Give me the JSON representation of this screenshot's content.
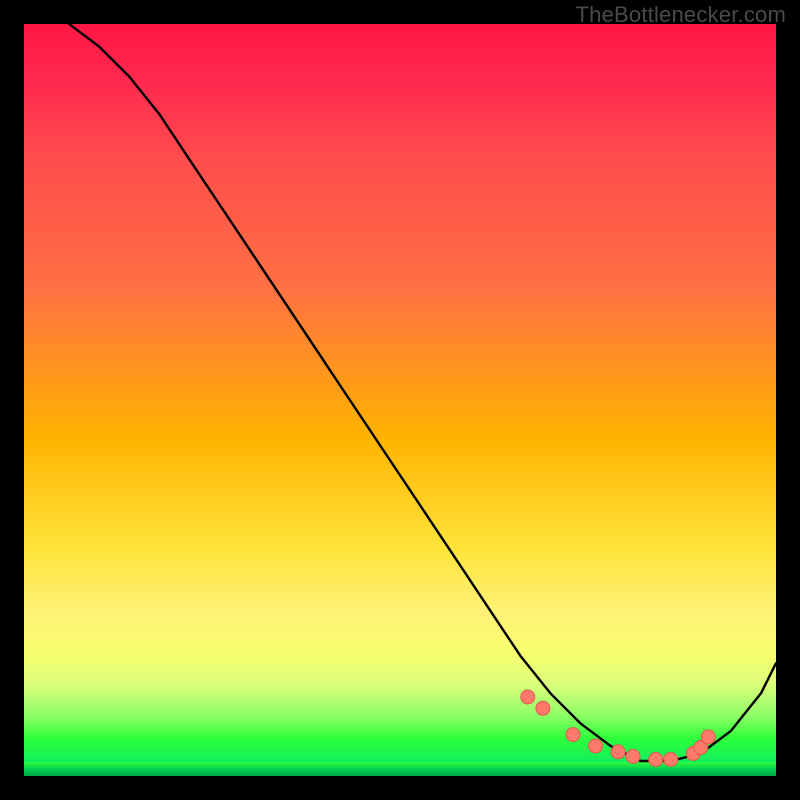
{
  "watermark": "TheBottlenecker.com",
  "chart_data": {
    "type": "line",
    "title": "",
    "xlabel": "",
    "ylabel": "",
    "xlim": [
      0,
      100
    ],
    "ylim": [
      0,
      100
    ],
    "grid": false,
    "series": [
      {
        "name": "curve",
        "x": [
          6,
          10,
          14,
          18,
          22,
          26,
          30,
          34,
          38,
          42,
          46,
          50,
          54,
          58,
          62,
          66,
          70,
          74,
          78,
          82,
          86,
          90,
          94,
          98,
          100
        ],
        "y": [
          100,
          97,
          93,
          88,
          82,
          76,
          70,
          64,
          58,
          52,
          46,
          40,
          34,
          28,
          22,
          16,
          11,
          7,
          4,
          2,
          2,
          3,
          6,
          11,
          15
        ]
      }
    ],
    "markers": {
      "name": "highlight-points",
      "x": [
        67,
        69,
        73,
        76,
        79,
        81,
        84,
        86,
        89,
        90,
        91
      ],
      "y": [
        10.5,
        9.0,
        5.5,
        4.0,
        3.2,
        2.6,
        2.2,
        2.2,
        3.0,
        3.8,
        5.2
      ]
    },
    "colors": {
      "line": "#000000",
      "markers": "#ff7a6b",
      "gradient_top": "#ff1744",
      "gradient_bottom": "#00c853"
    }
  }
}
